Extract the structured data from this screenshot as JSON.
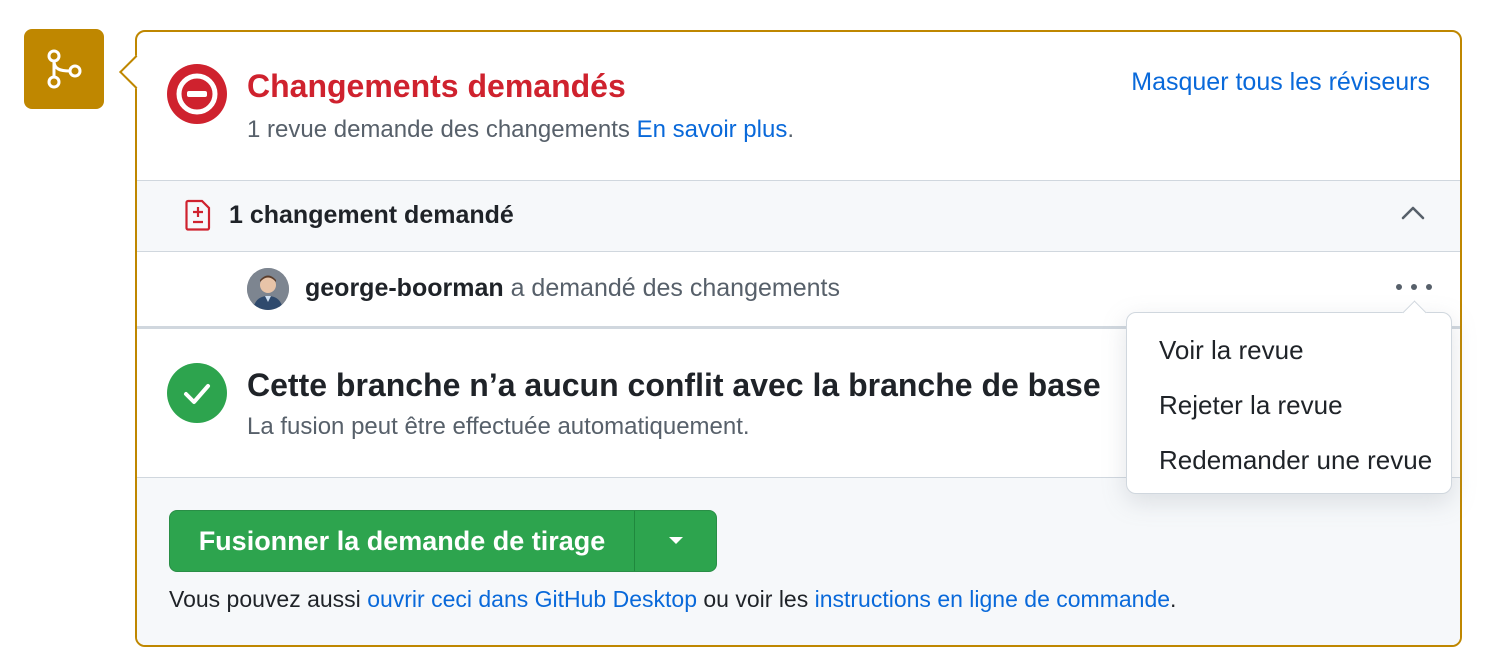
{
  "badge": {
    "icon": "git-merge-icon",
    "color": "#bf8700"
  },
  "changes": {
    "icon": "blocked-icon",
    "title": "Changements demandés",
    "subtitle": "1 revue demande des changements",
    "learn_more": "En savoir plus",
    "period": ".",
    "hide_reviewers": "Masquer tous les réviseurs"
  },
  "requested": {
    "icon": "file-diff-icon",
    "title": "1 changement demandé"
  },
  "reviewer": {
    "name": "george-boorman",
    "action": "a demandé des changements"
  },
  "merge_status": {
    "icon": "check-circle-icon",
    "title": "Cette branche n’a aucun conflit avec la branche de base",
    "subtitle": "La fusion peut être effectuée automatiquement."
  },
  "actions": {
    "merge_button": "Fusionner la demande de tirage",
    "text_before": "Vous pouvez aussi ",
    "desktop_link": "ouvrir ceci dans GitHub Desktop",
    "text_middle": " ou voir les ",
    "cli_link": "instructions en ligne de commande",
    "text_end": "."
  },
  "menu": {
    "items": [
      {
        "label": "Voir la revue"
      },
      {
        "label": "Rejeter la revue"
      },
      {
        "label": "Redemander une revue"
      }
    ]
  },
  "colors": {
    "accent_blue": "#0969da",
    "danger": "#cf222e",
    "success": "#2da44e",
    "warning_border": "#bf8700"
  }
}
